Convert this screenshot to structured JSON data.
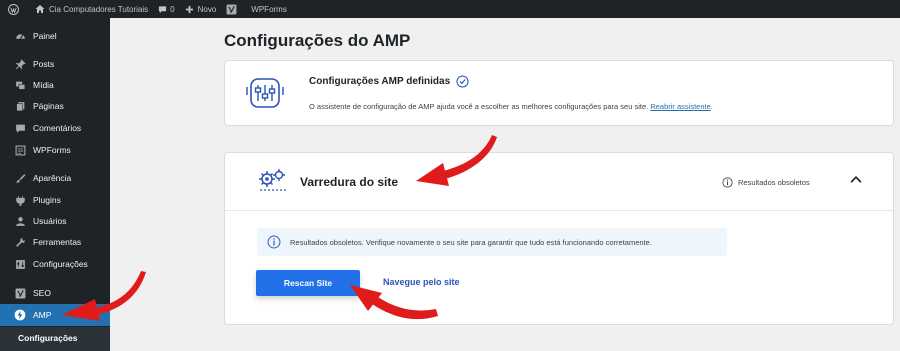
{
  "adminbar": {
    "site_name": "Cia Computadores Tutoriais",
    "comments_count": "0",
    "new_label": "Novo",
    "wpforms_label": "WPForms"
  },
  "sidebar": {
    "items": [
      {
        "label": "Painel",
        "icon": "dashboard-icon"
      },
      {
        "label": "Posts",
        "icon": "pin-icon"
      },
      {
        "label": "Mídia",
        "icon": "media-icon"
      },
      {
        "label": "Páginas",
        "icon": "pages-icon"
      },
      {
        "label": "Comentários",
        "icon": "comments-icon"
      },
      {
        "label": "WPForms",
        "icon": "wpforms-icon"
      },
      {
        "label": "Aparência",
        "icon": "brush-icon"
      },
      {
        "label": "Plugins",
        "icon": "plugin-icon"
      },
      {
        "label": "Usuários",
        "icon": "users-icon"
      },
      {
        "label": "Ferramentas",
        "icon": "tools-icon"
      },
      {
        "label": "Configurações",
        "icon": "settings-icon"
      },
      {
        "label": "SEO",
        "icon": "yoast-icon"
      },
      {
        "label": "AMP",
        "icon": "amp-icon"
      }
    ],
    "submenu": {
      "label": "Configurações"
    }
  },
  "main": {
    "title": "Configurações do AMP",
    "config_card": {
      "title": "Configurações AMP definidas",
      "description": "O assistente de configuração de AMP ajuda você a escolher as melhores configurações para seu site.",
      "link": "Reabrir assistente"
    },
    "scan_card": {
      "title": "Varredura do site",
      "status": "Resultados obsoletos",
      "notice": "Resultados obsoletos. Verifique novamente o seu site para garantir que tudo está funcionando corretamente.",
      "rescan_button": "Rescan Site",
      "browse_link": "Navegue pelo site"
    }
  },
  "colors": {
    "adminbar_bg": "#1d2327",
    "sidebar_active": "#2271b1",
    "primary_button": "#2271e8",
    "arrow": "#e01b1b"
  }
}
